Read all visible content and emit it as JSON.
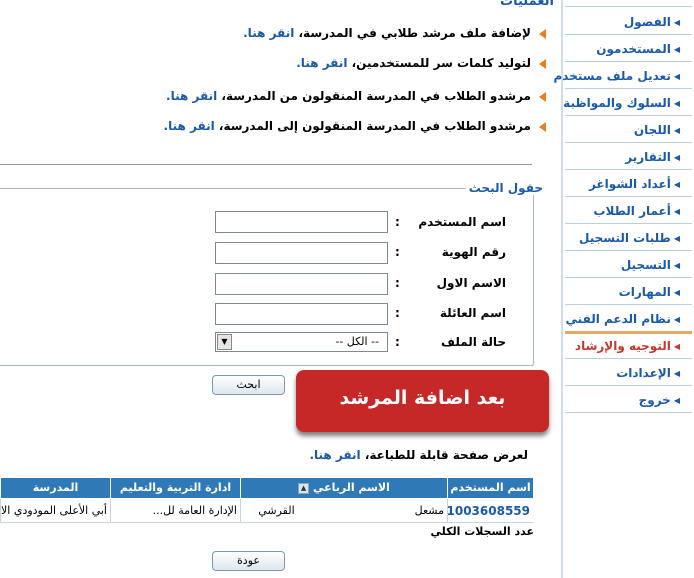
{
  "sidebar": {
    "items": [
      {
        "label": "الفصول"
      },
      {
        "label": "المستخدمون"
      },
      {
        "label": "تعديل ملف مستخدم"
      },
      {
        "label": "السلوك والمواظبة"
      },
      {
        "label": "اللجان"
      },
      {
        "label": "التقارير"
      },
      {
        "label": "أعداد الشواغر"
      },
      {
        "label": "أعمار الطلاب"
      },
      {
        "label": "طلبات التسجيل"
      },
      {
        "label": "التسجيل"
      },
      {
        "label": "المهارات"
      },
      {
        "label": "نظام الدعم الفني"
      },
      {
        "label": "التوجيه والإرشاد"
      },
      {
        "label": "الإعدادات"
      },
      {
        "label": "خروج"
      }
    ],
    "active_color": "#c0392b",
    "link_color": "#1a5aa6"
  },
  "operations": {
    "title": "العمليات",
    "items": [
      {
        "text": "لإضافة ملف مرشد طلابي في المدرسة، ",
        "link": "انقر هنا."
      },
      {
        "text": "لتوليد كلمات سر للمستخدمين، ",
        "link": "انقر هنا."
      },
      {
        "text": "مرشدو الطلاب في المدرسة المنقولون من المدرسة، ",
        "link": "انقر هنا."
      },
      {
        "text": "مرشدو الطلاب في المدرسة المنقولون إلى المدرسة، ",
        "link": "انقر هنا."
      }
    ]
  },
  "search": {
    "legend": "حقول البحث",
    "fields": [
      {
        "label": "اسم المستخدم",
        "colon": ":",
        "value": ""
      },
      {
        "label": "رقم الهوية",
        "colon": ":",
        "value": ""
      },
      {
        "label": "الاسم الاول",
        "colon": ":",
        "value": ""
      },
      {
        "label": "اسم العائلة",
        "colon": ":",
        "value": ""
      }
    ],
    "status_label": "حالة الملف",
    "status_colon": ":",
    "status_value": "-- الكل --",
    "search_button": "ابحث"
  },
  "banner": {
    "text": "بعد اضافة المرشد",
    "color": "#c62828"
  },
  "print": {
    "text": "لعرض صفحة قابلة للطباعة، ",
    "link": "انقر هنا."
  },
  "table": {
    "headers": [
      "اسم المستخدم",
      "الاسم الرباعي",
      "ادارة التربية والتعليم",
      "المدرسة"
    ],
    "rows": [
      {
        "username": "1003608559",
        "name_first": "مشعل",
        "name_last": "القرشي",
        "directorate": "الإدارة العامة لل...",
        "school": "أبي الأعلى المودودي الابتد"
      }
    ],
    "count_label": "عدد السجلات الكلي",
    "header_color": "#2f7ab6"
  },
  "back_button": "عودة"
}
